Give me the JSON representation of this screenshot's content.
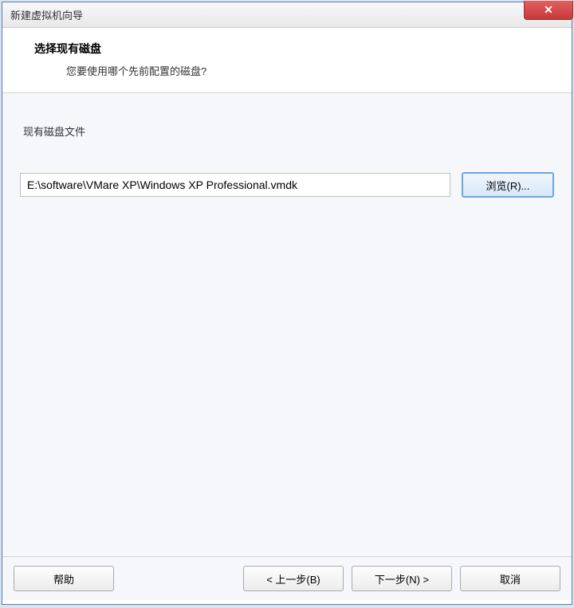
{
  "titlebar": {
    "title": "新建虚拟机向导"
  },
  "header": {
    "title": "选择现有磁盘",
    "subtitle": "您要使用哪个先前配置的磁盘?"
  },
  "groupbox": {
    "label": "现有磁盘文件"
  },
  "disk_path": {
    "value": "E:\\software\\VMare XP\\Windows XP Professional.vmdk"
  },
  "buttons": {
    "browse": "浏览(R)...",
    "help": "帮助",
    "back": "< 上一步(B)",
    "next": "下一步(N) >",
    "cancel": "取消"
  }
}
